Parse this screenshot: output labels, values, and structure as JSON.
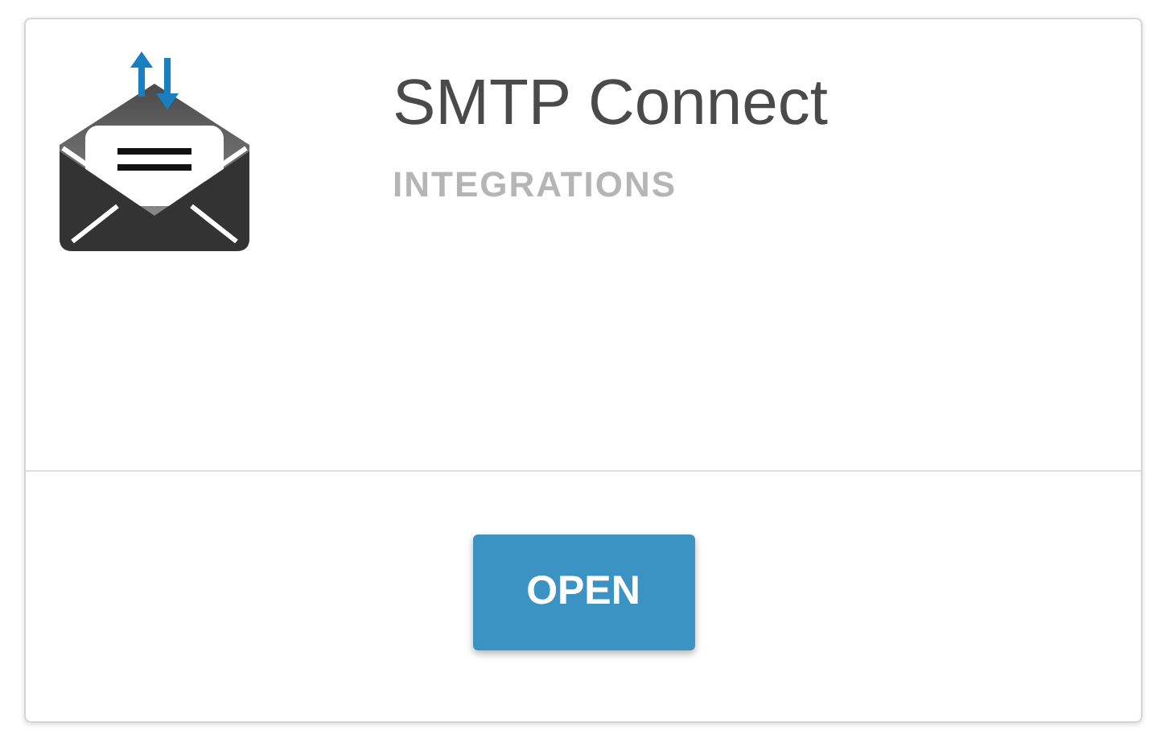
{
  "card": {
    "title": "SMTP Connect",
    "category": "INTEGRATIONS",
    "button": "OPEN"
  }
}
